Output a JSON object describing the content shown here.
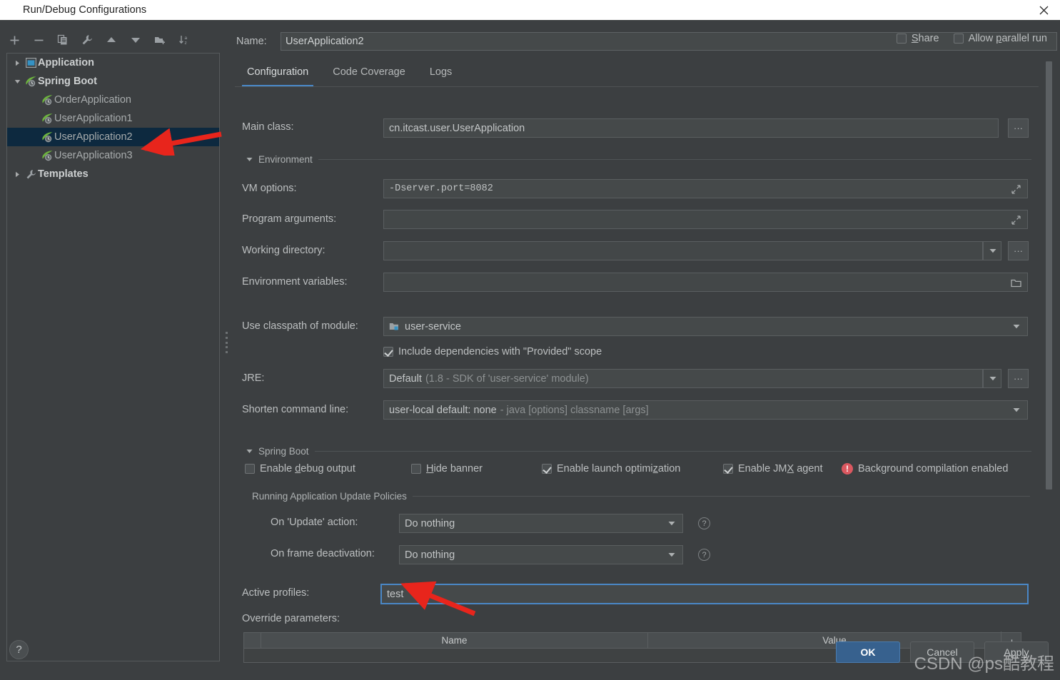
{
  "window": {
    "title": "Run/Debug Configurations",
    "app_icon": "intellij-idea-icon",
    "close_icon": "close-icon"
  },
  "toolbar": {
    "buttons": [
      {
        "name": "add-configuration-button",
        "icon": "plus-icon",
        "tooltip": "Add New Configuration"
      },
      {
        "name": "remove-configuration-button",
        "icon": "minus-icon",
        "tooltip": "Remove Configuration"
      },
      {
        "name": "copy-configuration-button",
        "icon": "copy-icon",
        "tooltip": "Copy Configuration"
      },
      {
        "name": "edit-templates-button",
        "icon": "wrench-icon",
        "tooltip": "Edit Templates"
      },
      {
        "name": "move-up-button",
        "icon": "arrow-up-icon",
        "tooltip": "Move Up"
      },
      {
        "name": "move-down-button",
        "icon": "arrow-down-icon",
        "tooltip": "Move Down"
      },
      {
        "name": "new-folder-button",
        "icon": "folder-add-icon",
        "tooltip": "Create New Folder"
      },
      {
        "name": "sort-configurations-button",
        "icon": "sort-alpha-icon",
        "tooltip": "Sort Configurations"
      }
    ]
  },
  "tree": {
    "items": [
      {
        "label": "Application",
        "level": 0,
        "expanded": false,
        "icon": "application-icon",
        "selected": false
      },
      {
        "label": "Spring Boot",
        "level": 0,
        "expanded": true,
        "icon": "spring-boot-icon",
        "selected": false
      },
      {
        "label": "OrderApplication",
        "level": 1,
        "icon": "spring-boot-icon",
        "selected": false
      },
      {
        "label": "UserApplication1",
        "level": 1,
        "icon": "spring-boot-icon",
        "selected": false
      },
      {
        "label": "UserApplication2",
        "level": 1,
        "icon": "spring-boot-icon",
        "selected": true
      },
      {
        "label": "UserApplication3",
        "level": 1,
        "icon": "spring-boot-icon",
        "selected": false
      },
      {
        "label": "Templates",
        "level": 0,
        "expanded": false,
        "icon": "wrench-icon",
        "selected": false
      }
    ]
  },
  "header": {
    "name_label": "Name:",
    "name_value": "UserApplication2",
    "share_label": "Share",
    "share_checked": false,
    "allow_parallel_label": "Allow parallel run",
    "allow_parallel_checked": false
  },
  "tabs": [
    {
      "label": "Configuration",
      "active": true
    },
    {
      "label": "Code Coverage",
      "active": false
    },
    {
      "label": "Logs",
      "active": false
    }
  ],
  "configuration": {
    "main_class": {
      "label": "Main class:",
      "value": "cn.itcast.user.UserApplication",
      "browse_label": "...",
      "browse_icon": "ellipsis-icon"
    },
    "environment_section": "Environment",
    "vm_options": {
      "label": "VM options:",
      "value": "-Dserver.port=8082",
      "placeholder": "",
      "expand_icon": "expand-diagonal-icon"
    },
    "program_arguments": {
      "label": "Program arguments:",
      "value": "",
      "placeholder": "",
      "expand_icon": "expand-diagonal-icon"
    },
    "working_directory": {
      "label": "Working directory:",
      "value": "",
      "placeholder": "",
      "dropdown_icon": "chevron-down-icon",
      "browse_label": "...",
      "browse_icon": "ellipsis-icon"
    },
    "environment_variables": {
      "label": "Environment variables:",
      "value": "",
      "placeholder": "",
      "browse_icon": "folder-icon"
    },
    "use_classpath_of_module": {
      "label": "Use classpath of module:",
      "value": "user-service",
      "value_icon": "module-icon",
      "dropdown_icon": "chevron-down-icon"
    },
    "include_provided": {
      "label": "Include dependencies with \"Provided\" scope",
      "checked": true
    },
    "jre": {
      "label": "JRE:",
      "value": "Default",
      "value_detail": "(1.8 - SDK of 'user-service' module)",
      "dropdown_icon": "chevron-down-icon",
      "browse_label": "...",
      "browse_icon": "ellipsis-icon"
    },
    "shorten_command_line": {
      "label": "Shorten command line:",
      "value": "user-local default: none",
      "value_detail": "- java [options] classname [args]",
      "dropdown_icon": "chevron-down-icon"
    },
    "spring_boot_section": "Spring Boot",
    "spring_checks": [
      {
        "label": "Enable debug output",
        "checked": false,
        "mnemonic": "d",
        "name": "enable-debug-output-checkbox"
      },
      {
        "label": "Hide banner",
        "checked": false,
        "mnemonic": "H",
        "name": "hide-banner-checkbox"
      },
      {
        "label": "Enable launch optimization",
        "checked": true,
        "mnemonic": "z",
        "name": "enable-launch-optimization-checkbox"
      },
      {
        "label": "Enable JMX agent",
        "checked": true,
        "mnemonic": "X",
        "name": "enable-jmx-agent-checkbox"
      }
    ],
    "background_compilation": {
      "label": "Background compilation enabled",
      "icon": "error-badge-icon",
      "icon_color": "#db5860"
    },
    "update_policies_section": "Running Application Update Policies",
    "on_update_action": {
      "label": "On 'Update' action:",
      "value": "Do nothing",
      "help_icon": "help-circle-icon",
      "dropdown_icon": "chevron-down-icon"
    },
    "on_frame_deactivation": {
      "label": "On frame deactivation:",
      "value": "Do nothing",
      "help_icon": "help-circle-icon",
      "dropdown_icon": "chevron-down-icon"
    },
    "active_profiles": {
      "label": "Active profiles:",
      "value": "test",
      "focused": true
    },
    "override_parameters": {
      "label": "Override parameters:",
      "columns": [
        "",
        "Name",
        "Value"
      ],
      "rows": [],
      "add_label": "+",
      "add_icon": "plus-icon"
    }
  },
  "footer": {
    "help_icon": "help-circle-icon",
    "ok_label": "OK",
    "cancel_label": "Cancel",
    "apply_label": "Apply",
    "accent_color": "#37618e"
  },
  "annotations": {
    "watermark": "CSDN @ps酷教程",
    "arrows": [
      {
        "name": "annotation-arrow-tree",
        "color": "#e8251c",
        "points_to": "UserApplication2 tree item"
      },
      {
        "name": "annotation-arrow-active-profiles",
        "color": "#e8251c",
        "points_to": "Active profiles field"
      }
    ]
  },
  "colors": {
    "dialog_bg": "#3c3f41",
    "field_bg": "#45494a",
    "selection_bg": "#0d293f",
    "tab_accent": "#4a88c7",
    "text": "#bbbbbb",
    "spring_green": "#6db33f"
  }
}
